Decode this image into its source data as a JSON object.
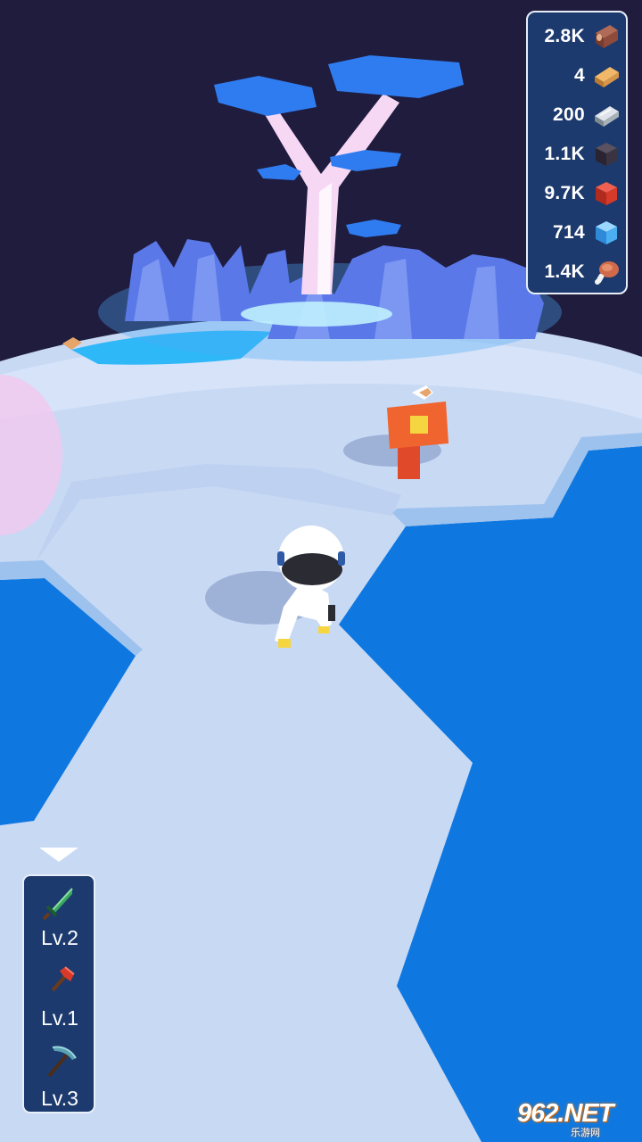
{
  "resources": [
    {
      "value": "2.8K",
      "icon": "wood-log-icon",
      "color": "#8a4a3a"
    },
    {
      "value": "4",
      "icon": "plank-icon",
      "color": "#e0a050"
    },
    {
      "value": "200",
      "icon": "iron-bar-icon",
      "color": "#b8c0c8"
    },
    {
      "value": "1.1K",
      "icon": "coal-cube-icon",
      "color": "#3a3340"
    },
    {
      "value": "9.7K",
      "icon": "red-ore-cube-icon",
      "color": "#d83a2a"
    },
    {
      "value": "714",
      "icon": "ice-cube-icon",
      "color": "#4aaef0"
    },
    {
      "value": "1.4K",
      "icon": "meat-icon",
      "color": "#d06a4a"
    }
  ],
  "tools": [
    {
      "level": "Lv.2",
      "icon": "sword-icon",
      "color": "#3aa860"
    },
    {
      "level": "Lv.1",
      "icon": "axe-icon",
      "color": "#d83a2a"
    },
    {
      "level": "Lv.3",
      "icon": "pickaxe-icon",
      "color": "#5aa0b0"
    }
  ],
  "watermark": {
    "text": "962.NET",
    "sub": "乐游网"
  },
  "colors": {
    "sky": "#1f1c3e",
    "ground": "#c8d9f4",
    "water": "#0f78e0",
    "crystal": "#5a78e8",
    "leaves": "#2f7cf0"
  }
}
